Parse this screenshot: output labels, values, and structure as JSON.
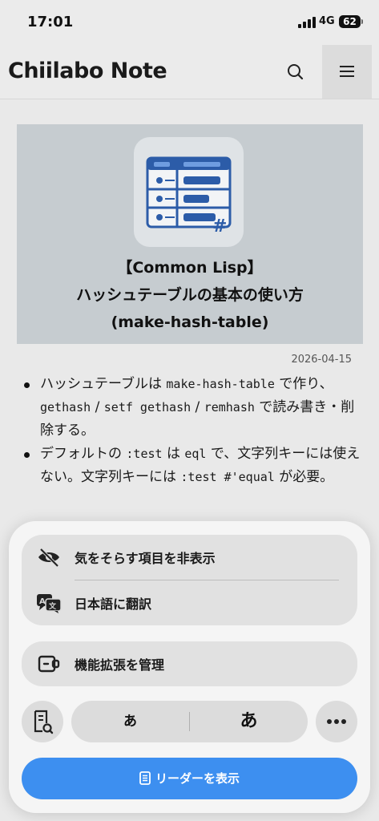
{
  "status_bar": {
    "time": "17:01",
    "network": "4G",
    "battery": "62"
  },
  "header": {
    "site_title": "Chiilabo Note"
  },
  "article": {
    "thumbnail_title_1": "【Common Lisp】",
    "thumbnail_title_2": "ハッシュテーブルの基本の使い方",
    "thumbnail_title_3": "(make-hash-table)",
    "date": "2026-04-15"
  },
  "bullets": {
    "b1_t1": "ハッシュテーブルは ",
    "b1_c1": "make-hash-table",
    "b1_t2": " で作り、",
    "b1_c2": "gethash",
    "b1_t3": " / ",
    "b1_c3": "setf gethash",
    "b1_t4": " / ",
    "b1_c4": "remhash",
    "b1_t5": " で読み書き・削除する。",
    "b2_t1": "デフォルトの ",
    "b2_c1": ":test",
    "b2_t2": " は ",
    "b2_c2": "eql",
    "b2_t3": " で、文字列キーには使えない。文字列キーには ",
    "b2_c3": ":test #'equal",
    "b2_t4": " が必要。"
  },
  "sheet": {
    "hide_distractions": "気をそらす項目を非表示",
    "translate": "日本語に翻訳",
    "manage_extensions": "機能拡張を管理",
    "font_smaller": "あ",
    "font_larger": "あ",
    "show_reader": "リーダーを表示"
  },
  "colors": {
    "accent": "#3d8ff0",
    "thumbnail_bg": "#c6ccd0"
  },
  "icons": [
    "search-icon",
    "hamburger-menu-icon",
    "eye-slash-icon",
    "translate-icon",
    "extension-icon",
    "page-search-icon",
    "more-icon",
    "reader-icon"
  ]
}
